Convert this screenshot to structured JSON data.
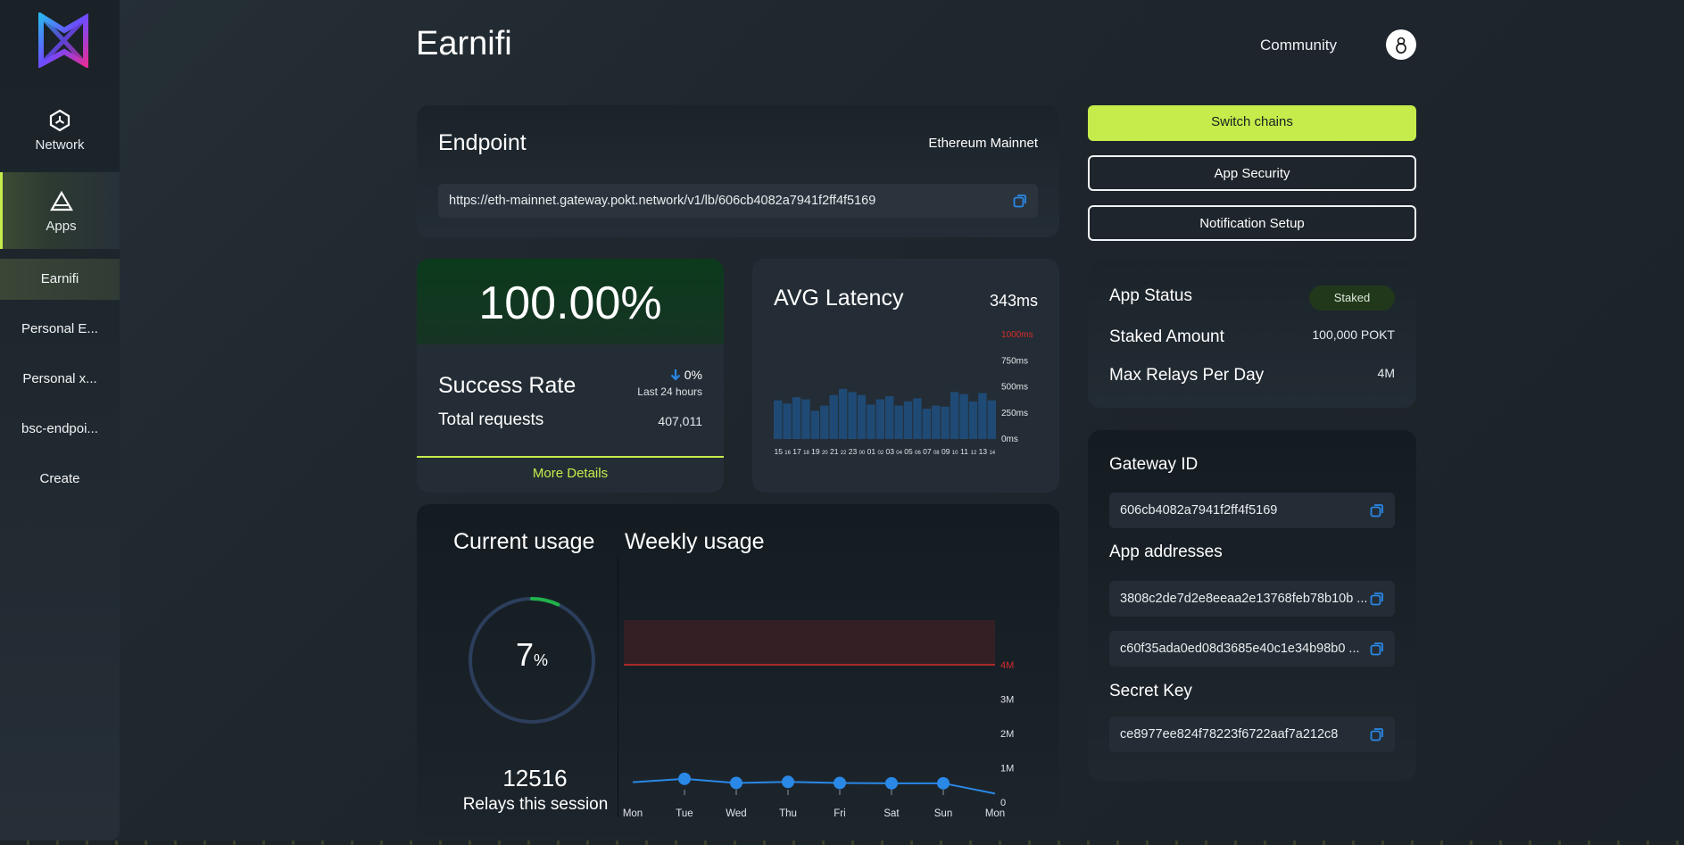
{
  "sidebar": {
    "nav": [
      {
        "label": "Network",
        "icon": "network-icon"
      },
      {
        "label": "Apps",
        "icon": "apps-icon"
      }
    ],
    "apps": [
      "Earnifi",
      "Personal E...",
      "Personal x...",
      "bsc-endpoi...",
      "Create"
    ]
  },
  "header": {
    "title": "Earnifi",
    "community": "Community"
  },
  "endpoint": {
    "title": "Endpoint",
    "chain": "Ethereum Mainnet",
    "url": "https://eth-mainnet.gateway.pokt.network/v1/lb/606cb4082a7941f2ff4f5169"
  },
  "success": {
    "rate": "100.00%",
    "label": "Success Rate",
    "change": "0%",
    "change_period": "Last 24 hours",
    "total_label": "Total requests",
    "total_value": "407,011",
    "more": "More Details"
  },
  "latency": {
    "title": "AVG Latency",
    "value": "343ms"
  },
  "usage": {
    "current_title": "Current usage",
    "weekly_title": "Weekly usage",
    "percent": "7",
    "percent_sign": "%",
    "percent_value": 0.07,
    "relays": "12516",
    "relays_label": "Relays this session"
  },
  "actions": {
    "switch": "Switch chains",
    "security": "App Security",
    "notify": "Notification Setup"
  },
  "status": {
    "app_status_label": "App Status",
    "app_status_value": "Staked",
    "staked_label": "Staked Amount",
    "staked_value": "100,000 POKT",
    "relays_label": "Max Relays Per Day",
    "relays_value": "4M"
  },
  "gateway": {
    "id_label": "Gateway ID",
    "id_value": "606cb4082a7941f2ff4f5169",
    "addresses_label": "App addresses",
    "addresses": [
      "3808c2de7d2e8eeaa2e13768feb78b10b ...",
      "c60f35ada0ed08d3685e40c1e34b98b0 ..."
    ],
    "secret_label": "Secret Key",
    "secret_value": "ce8977ee824f78223f6722aaf7a212c8"
  },
  "colors": {
    "accent": "#c5ec4b",
    "bar": "#1f4a75",
    "line": "#2a88e6",
    "limit": "#d42b2b",
    "gauge_track": "#2c3e5c",
    "gauge_fill": "#21b24a"
  },
  "chart_data": [
    {
      "type": "bar",
      "title": "AVG Latency",
      "categories": [
        "15",
        "16",
        "17",
        "18",
        "19",
        "20",
        "21",
        "22",
        "23",
        "00",
        "01",
        "02",
        "03",
        "04",
        "05",
        "06",
        "07",
        "08",
        "09",
        "10",
        "11",
        "12",
        "13",
        "14"
      ],
      "values": [
        370,
        340,
        400,
        380,
        270,
        320,
        420,
        480,
        450,
        420,
        330,
        380,
        410,
        320,
        360,
        390,
        290,
        320,
        310,
        450,
        430,
        360,
        440,
        370
      ],
      "y_ticks": [
        "0ms",
        "250ms",
        "500ms",
        "750ms",
        "1000ms"
      ],
      "ylim": [
        0,
        1000
      ]
    },
    {
      "type": "line",
      "title": "Weekly usage",
      "categories": [
        "Mon",
        "Tue",
        "Wed",
        "Thu",
        "Fri",
        "Sat",
        "Sun",
        "Mon"
      ],
      "values": [
        580000,
        680000,
        560000,
        590000,
        560000,
        550000,
        550000,
        250000
      ],
      "y_ticks": [
        "0",
        "1M",
        "2M",
        "3M",
        "4M"
      ],
      "ylim": [
        0,
        4000000
      ],
      "limit": 4000000
    }
  ]
}
